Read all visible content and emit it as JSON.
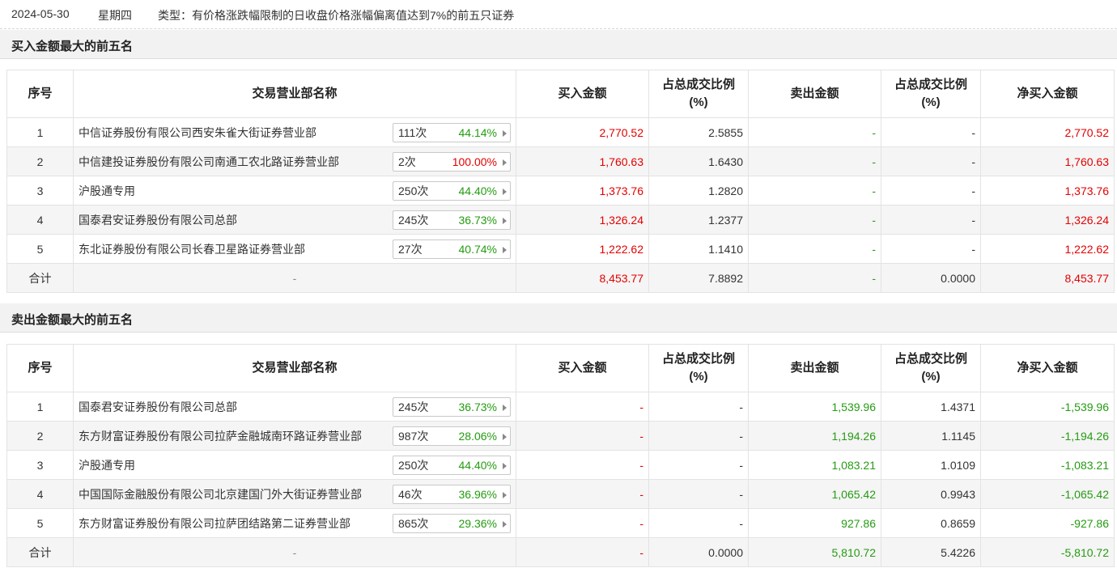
{
  "header": {
    "date": "2024-05-30",
    "weekday": "星期四",
    "type_text": "类型：有价格涨跌幅限制的日收盘价格涨幅偏离值达到7%的前五只证券"
  },
  "columns": {
    "rank": "序号",
    "name": "交易营业部名称",
    "buy": "买入金额",
    "ratio1_l1": "占总成交比例",
    "ratio1_l2": "(%)",
    "sell": "卖出金额",
    "ratio2_l1": "占总成交比例",
    "ratio2_l2": "(%)",
    "net": "净买入金额"
  },
  "buy_section": {
    "title": "买入金额最大的前五名",
    "rows": [
      {
        "rank": "1",
        "name": "中信证券股份有限公司西安朱雀大街证券营业部",
        "count": "111次",
        "pct": "44.14%",
        "pct_color": "green",
        "buy": "2,770.52",
        "buy_ratio": "2.5855",
        "sell": "-",
        "sell_ratio": "-",
        "net": "2,770.52"
      },
      {
        "rank": "2",
        "name": "中信建投证券股份有限公司南通工农北路证券营业部",
        "count": "2次",
        "pct": "100.00%",
        "pct_color": "red",
        "buy": "1,760.63",
        "buy_ratio": "1.6430",
        "sell": "-",
        "sell_ratio": "-",
        "net": "1,760.63"
      },
      {
        "rank": "3",
        "name": "沪股通专用",
        "count": "250次",
        "pct": "44.40%",
        "pct_color": "green",
        "buy": "1,373.76",
        "buy_ratio": "1.2820",
        "sell": "-",
        "sell_ratio": "-",
        "net": "1,373.76"
      },
      {
        "rank": "4",
        "name": "国泰君安证券股份有限公司总部",
        "count": "245次",
        "pct": "36.73%",
        "pct_color": "green",
        "buy": "1,326.24",
        "buy_ratio": "1.2377",
        "sell": "-",
        "sell_ratio": "-",
        "net": "1,326.24"
      },
      {
        "rank": "5",
        "name": "东北证券股份有限公司长春卫星路证券营业部",
        "count": "27次",
        "pct": "40.74%",
        "pct_color": "green",
        "buy": "1,222.62",
        "buy_ratio": "1.1410",
        "sell": "-",
        "sell_ratio": "-",
        "net": "1,222.62"
      }
    ],
    "total": {
      "label": "合计",
      "name": "-",
      "buy": "8,453.77",
      "buy_ratio": "7.8892",
      "sell": "-",
      "sell_ratio": "0.0000",
      "net": "8,453.77"
    }
  },
  "sell_section": {
    "title": "卖出金额最大的前五名",
    "rows": [
      {
        "rank": "1",
        "name": "国泰君安证券股份有限公司总部",
        "count": "245次",
        "pct": "36.73%",
        "pct_color": "green",
        "buy": "-",
        "buy_ratio": "-",
        "sell": "1,539.96",
        "sell_ratio": "1.4371",
        "net": "-1,539.96"
      },
      {
        "rank": "2",
        "name": "东方财富证券股份有限公司拉萨金融城南环路证券营业部",
        "count": "987次",
        "pct": "28.06%",
        "pct_color": "green",
        "buy": "-",
        "buy_ratio": "-",
        "sell": "1,194.26",
        "sell_ratio": "1.1145",
        "net": "-1,194.26"
      },
      {
        "rank": "3",
        "name": "沪股通专用",
        "count": "250次",
        "pct": "44.40%",
        "pct_color": "green",
        "buy": "-",
        "buy_ratio": "-",
        "sell": "1,083.21",
        "sell_ratio": "1.0109",
        "net": "-1,083.21"
      },
      {
        "rank": "4",
        "name": "中国国际金融股份有限公司北京建国门外大街证券营业部",
        "count": "46次",
        "pct": "36.96%",
        "pct_color": "green",
        "buy": "-",
        "buy_ratio": "-",
        "sell": "1,065.42",
        "sell_ratio": "0.9943",
        "net": "-1,065.42"
      },
      {
        "rank": "5",
        "name": "东方财富证券股份有限公司拉萨团结路第二证券营业部",
        "count": "865次",
        "pct": "29.36%",
        "pct_color": "green",
        "buy": "-",
        "buy_ratio": "-",
        "sell": "927.86",
        "sell_ratio": "0.8659",
        "net": "-927.86"
      }
    ],
    "total": {
      "label": "合计",
      "name": "-",
      "buy": "-",
      "buy_ratio": "0.0000",
      "sell": "5,810.72",
      "sell_ratio": "5.4226",
      "net": "-5,810.72"
    }
  },
  "colors": {
    "up": "#e30000",
    "down": "#249c11",
    "header_bg": "#f2f2f2",
    "row_alt": "#f5f5f5"
  },
  "icons": {
    "expand": "caret-right-icon"
  }
}
